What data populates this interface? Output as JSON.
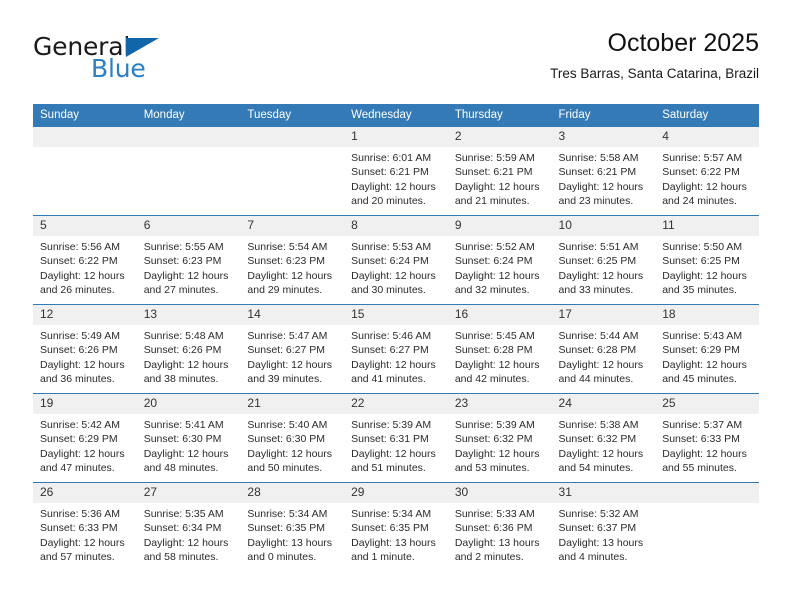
{
  "brand": {
    "name_part1": "General",
    "name_part2": "Blue",
    "triangle_color": "#1166aa",
    "blue_color": "#2a7fc9"
  },
  "header": {
    "title": "October 2025",
    "subtitle": "Tres Barras, Santa Catarina, Brazil"
  },
  "theme": {
    "header_bg": "#337ab7",
    "daynum_bg": "#f0f0f0",
    "row_border": "#337ab7",
    "text": "#2b2b2b"
  },
  "weekdays": [
    "Sunday",
    "Monday",
    "Tuesday",
    "Wednesday",
    "Thursday",
    "Friday",
    "Saturday"
  ],
  "labels": {
    "sunrise_prefix": "Sunrise:",
    "sunset_prefix": "Sunset:",
    "daylight_prefix": "Daylight:"
  },
  "weeks": [
    [
      {
        "day": "",
        "blank": true,
        "line1": "",
        "line2": "",
        "line3": "",
        "line4": ""
      },
      {
        "day": "",
        "blank": true,
        "line1": "",
        "line2": "",
        "line3": "",
        "line4": ""
      },
      {
        "day": "",
        "blank": true,
        "line1": "",
        "line2": "",
        "line3": "",
        "line4": ""
      },
      {
        "day": "1",
        "blank": false,
        "line1": "Sunrise: 6:01 AM",
        "line2": "Sunset: 6:21 PM",
        "line3": "Daylight: 12 hours",
        "line4": "and 20 minutes."
      },
      {
        "day": "2",
        "blank": false,
        "line1": "Sunrise: 5:59 AM",
        "line2": "Sunset: 6:21 PM",
        "line3": "Daylight: 12 hours",
        "line4": "and 21 minutes."
      },
      {
        "day": "3",
        "blank": false,
        "line1": "Sunrise: 5:58 AM",
        "line2": "Sunset: 6:21 PM",
        "line3": "Daylight: 12 hours",
        "line4": "and 23 minutes."
      },
      {
        "day": "4",
        "blank": false,
        "line1": "Sunrise: 5:57 AM",
        "line2": "Sunset: 6:22 PM",
        "line3": "Daylight: 12 hours",
        "line4": "and 24 minutes."
      }
    ],
    [
      {
        "day": "5",
        "blank": false,
        "line1": "Sunrise: 5:56 AM",
        "line2": "Sunset: 6:22 PM",
        "line3": "Daylight: 12 hours",
        "line4": "and 26 minutes."
      },
      {
        "day": "6",
        "blank": false,
        "line1": "Sunrise: 5:55 AM",
        "line2": "Sunset: 6:23 PM",
        "line3": "Daylight: 12 hours",
        "line4": "and 27 minutes."
      },
      {
        "day": "7",
        "blank": false,
        "line1": "Sunrise: 5:54 AM",
        "line2": "Sunset: 6:23 PM",
        "line3": "Daylight: 12 hours",
        "line4": "and 29 minutes."
      },
      {
        "day": "8",
        "blank": false,
        "line1": "Sunrise: 5:53 AM",
        "line2": "Sunset: 6:24 PM",
        "line3": "Daylight: 12 hours",
        "line4": "and 30 minutes."
      },
      {
        "day": "9",
        "blank": false,
        "line1": "Sunrise: 5:52 AM",
        "line2": "Sunset: 6:24 PM",
        "line3": "Daylight: 12 hours",
        "line4": "and 32 minutes."
      },
      {
        "day": "10",
        "blank": false,
        "line1": "Sunrise: 5:51 AM",
        "line2": "Sunset: 6:25 PM",
        "line3": "Daylight: 12 hours",
        "line4": "and 33 minutes."
      },
      {
        "day": "11",
        "blank": false,
        "line1": "Sunrise: 5:50 AM",
        "line2": "Sunset: 6:25 PM",
        "line3": "Daylight: 12 hours",
        "line4": "and 35 minutes."
      }
    ],
    [
      {
        "day": "12",
        "blank": false,
        "line1": "Sunrise: 5:49 AM",
        "line2": "Sunset: 6:26 PM",
        "line3": "Daylight: 12 hours",
        "line4": "and 36 minutes."
      },
      {
        "day": "13",
        "blank": false,
        "line1": "Sunrise: 5:48 AM",
        "line2": "Sunset: 6:26 PM",
        "line3": "Daylight: 12 hours",
        "line4": "and 38 minutes."
      },
      {
        "day": "14",
        "blank": false,
        "line1": "Sunrise: 5:47 AM",
        "line2": "Sunset: 6:27 PM",
        "line3": "Daylight: 12 hours",
        "line4": "and 39 minutes."
      },
      {
        "day": "15",
        "blank": false,
        "line1": "Sunrise: 5:46 AM",
        "line2": "Sunset: 6:27 PM",
        "line3": "Daylight: 12 hours",
        "line4": "and 41 minutes."
      },
      {
        "day": "16",
        "blank": false,
        "line1": "Sunrise: 5:45 AM",
        "line2": "Sunset: 6:28 PM",
        "line3": "Daylight: 12 hours",
        "line4": "and 42 minutes."
      },
      {
        "day": "17",
        "blank": false,
        "line1": "Sunrise: 5:44 AM",
        "line2": "Sunset: 6:28 PM",
        "line3": "Daylight: 12 hours",
        "line4": "and 44 minutes."
      },
      {
        "day": "18",
        "blank": false,
        "line1": "Sunrise: 5:43 AM",
        "line2": "Sunset: 6:29 PM",
        "line3": "Daylight: 12 hours",
        "line4": "and 45 minutes."
      }
    ],
    [
      {
        "day": "19",
        "blank": false,
        "line1": "Sunrise: 5:42 AM",
        "line2": "Sunset: 6:29 PM",
        "line3": "Daylight: 12 hours",
        "line4": "and 47 minutes."
      },
      {
        "day": "20",
        "blank": false,
        "line1": "Sunrise: 5:41 AM",
        "line2": "Sunset: 6:30 PM",
        "line3": "Daylight: 12 hours",
        "line4": "and 48 minutes."
      },
      {
        "day": "21",
        "blank": false,
        "line1": "Sunrise: 5:40 AM",
        "line2": "Sunset: 6:30 PM",
        "line3": "Daylight: 12 hours",
        "line4": "and 50 minutes."
      },
      {
        "day": "22",
        "blank": false,
        "line1": "Sunrise: 5:39 AM",
        "line2": "Sunset: 6:31 PM",
        "line3": "Daylight: 12 hours",
        "line4": "and 51 minutes."
      },
      {
        "day": "23",
        "blank": false,
        "line1": "Sunrise: 5:39 AM",
        "line2": "Sunset: 6:32 PM",
        "line3": "Daylight: 12 hours",
        "line4": "and 53 minutes."
      },
      {
        "day": "24",
        "blank": false,
        "line1": "Sunrise: 5:38 AM",
        "line2": "Sunset: 6:32 PM",
        "line3": "Daylight: 12 hours",
        "line4": "and 54 minutes."
      },
      {
        "day": "25",
        "blank": false,
        "line1": "Sunrise: 5:37 AM",
        "line2": "Sunset: 6:33 PM",
        "line3": "Daylight: 12 hours",
        "line4": "and 55 minutes."
      }
    ],
    [
      {
        "day": "26",
        "blank": false,
        "line1": "Sunrise: 5:36 AM",
        "line2": "Sunset: 6:33 PM",
        "line3": "Daylight: 12 hours",
        "line4": "and 57 minutes."
      },
      {
        "day": "27",
        "blank": false,
        "line1": "Sunrise: 5:35 AM",
        "line2": "Sunset: 6:34 PM",
        "line3": "Daylight: 12 hours",
        "line4": "and 58 minutes."
      },
      {
        "day": "28",
        "blank": false,
        "line1": "Sunrise: 5:34 AM",
        "line2": "Sunset: 6:35 PM",
        "line3": "Daylight: 13 hours",
        "line4": "and 0 minutes."
      },
      {
        "day": "29",
        "blank": false,
        "line1": "Sunrise: 5:34 AM",
        "line2": "Sunset: 6:35 PM",
        "line3": "Daylight: 13 hours",
        "line4": "and 1 minute."
      },
      {
        "day": "30",
        "blank": false,
        "line1": "Sunrise: 5:33 AM",
        "line2": "Sunset: 6:36 PM",
        "line3": "Daylight: 13 hours",
        "line4": "and 2 minutes."
      },
      {
        "day": "31",
        "blank": false,
        "line1": "Sunrise: 5:32 AM",
        "line2": "Sunset: 6:37 PM",
        "line3": "Daylight: 13 hours",
        "line4": "and 4 minutes."
      },
      {
        "day": "",
        "blank": true,
        "line1": "",
        "line2": "",
        "line3": "",
        "line4": ""
      }
    ]
  ]
}
